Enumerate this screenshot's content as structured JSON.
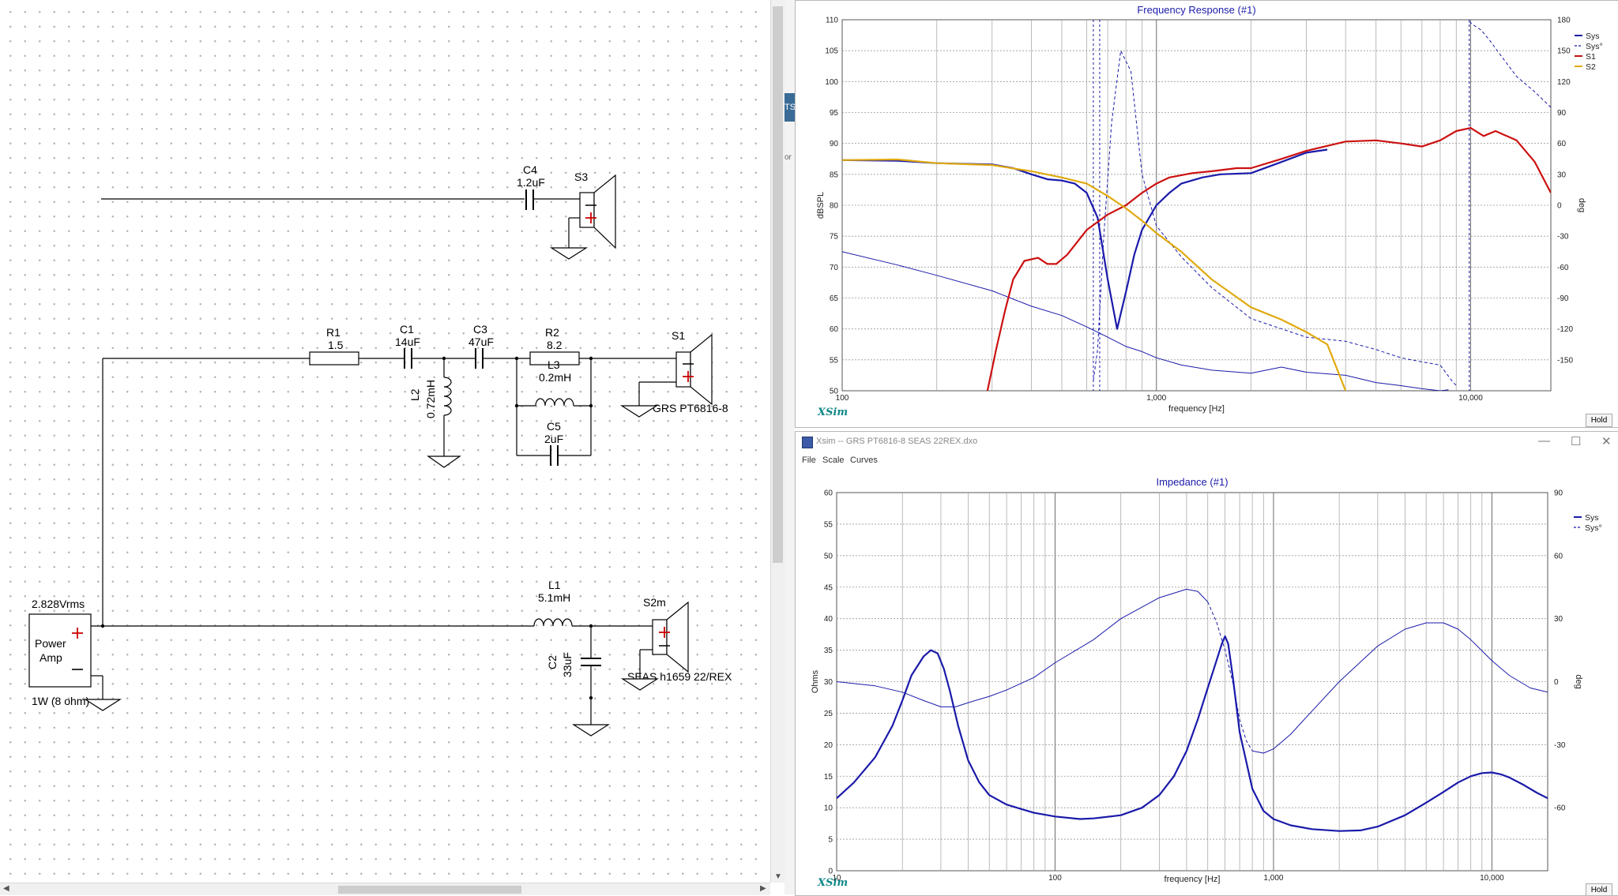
{
  "schematic": {
    "source": "2.828Vrms",
    "amp_line1": "Power",
    "amp_line2": "Amp",
    "amp_power": "1W (8 ohm)",
    "c4": {
      "name": "C4",
      "value": "1.2uF"
    },
    "s3": "S3",
    "r1": {
      "name": "R1",
      "value": "1.5"
    },
    "c1": {
      "name": "C1",
      "value": "14uF"
    },
    "c3": {
      "name": "C3",
      "value": "47uF"
    },
    "r2": {
      "name": "R2",
      "value": "8.2"
    },
    "l3": {
      "name": "L3",
      "value": "0.2mH"
    },
    "c5": {
      "name": "C5",
      "value": "2uF"
    },
    "l2": {
      "name": "L2",
      "value": "0.72mH"
    },
    "s1": {
      "name": "S1",
      "model": "GRS PT6816-8"
    },
    "l1": {
      "name": "L1",
      "value": "5.1mH"
    },
    "c2": {
      "name": "C2",
      "value": "33uF"
    },
    "s2": {
      "name": "S2m",
      "model": "SEAS h1659 22/REX"
    }
  },
  "background_fragments": {
    "tab": "TS",
    "text": "or"
  },
  "freq_window": {
    "hold": "Hold",
    "logo": "XSim"
  },
  "imp_window": {
    "title": "Xsim -- GRS PT6816-8 SEAS 22REX.dxo",
    "menu": [
      "File",
      "Scale",
      "Curves"
    ],
    "hold": "Hold",
    "logo": "XSim"
  },
  "colors": {
    "sys": "#1a1aaa",
    "s1": "#cc1111",
    "s2": "#e0aa10",
    "grid": "#888888"
  },
  "chart_data": [
    {
      "type": "line",
      "title": "Frequency Response (#1)",
      "xlabel": "frequency [Hz]",
      "ylabel": "dBSPL",
      "y2label": "deg",
      "xscale": "log",
      "xlim": [
        100,
        18000
      ],
      "ylim": [
        50,
        110
      ],
      "y2lim": [
        -180,
        180
      ],
      "xticks": [
        {
          "v": 100,
          "label": "100"
        },
        {
          "v": 1000,
          "label": "1,000"
        },
        {
          "v": 10000,
          "label": "10,000"
        }
      ],
      "yticks": [
        50,
        55,
        60,
        65,
        70,
        75,
        80,
        85,
        90,
        95,
        100,
        105,
        110
      ],
      "y2ticks": [
        -150,
        -120,
        -90,
        -60,
        -30,
        0,
        30,
        60,
        90,
        120,
        150,
        180
      ],
      "grid": true,
      "legend_position": "top-right",
      "legend": [
        "Sys",
        "Sys°",
        "S1",
        "S2"
      ],
      "series": [
        {
          "name": "Sys",
          "axis": "left",
          "color": "#1a1aaa",
          "width": 2.2,
          "dash": "",
          "x": [
            100,
            150,
            200,
            300,
            350,
            400,
            450,
            500,
            550,
            600,
            650,
            700,
            750,
            800,
            850,
            900,
            1000,
            1100,
            1200,
            1400,
            1600,
            2000,
            2500,
            3000,
            3500
          ],
          "y": [
            87.3,
            87.2,
            86.8,
            86.6,
            86.0,
            85.0,
            84.2,
            84.0,
            83.5,
            82.0,
            78.0,
            68.0,
            60.0,
            66.0,
            72.0,
            76.0,
            80.0,
            82.0,
            83.5,
            84.5,
            85.0,
            85.2,
            87.0,
            88.5,
            89.0
          ]
        },
        {
          "name": "Sys°",
          "axis": "right",
          "color": "#1a1aaa",
          "width": 1,
          "dash": "4,3",
          "x": [
            630,
            650,
            680,
            720,
            770,
            830,
            900,
            1000,
            1200,
            1500,
            2000,
            3000,
            4000,
            5000,
            6000,
            7000,
            8000,
            8700,
            9000
          ],
          "y": [
            -170,
            -140,
            -30,
            80,
            150,
            130,
            30,
            -20,
            -50,
            -80,
            -110,
            -128,
            -132,
            -140,
            -148,
            -152,
            -155,
            -170,
            -175
          ]
        },
        {
          "name": "Sys°",
          "axis": "right",
          "color": "#1a1aaa",
          "width": 1,
          "dash": "4,3",
          "x": [
            9900,
            10200,
            10800,
            11500,
            12500,
            14000,
            16000,
            18000
          ],
          "y": [
            178,
            175,
            170,
            160,
            145,
            125,
            110,
            95
          ]
        },
        {
          "name": "Sys°",
          "axis": "right",
          "color": "#1a1aaa",
          "width": 1,
          "dash": "",
          "x": [
            100,
            150,
            200,
            300,
            400,
            500,
            600,
            700,
            800,
            900,
            1000,
            1200,
            1500,
            2000,
            2500,
            3000,
            4000,
            5000,
            6000,
            7000,
            8000,
            8500
          ],
          "y": [
            -45,
            -58,
            -68,
            -83,
            -98,
            -107,
            -118,
            -128,
            -137,
            -142,
            -148,
            -155,
            -160,
            -163,
            -157,
            -162,
            -165,
            -172,
            -175,
            -178,
            -180,
            -179
          ]
        },
        {
          "name": "S1",
          "axis": "left",
          "color": "#cc1111",
          "width": 2.2,
          "dash": "",
          "x": [
            290,
            310,
            330,
            350,
            380,
            420,
            450,
            480,
            520,
            600,
            700,
            800,
            900,
            1000,
            1100,
            1300,
            1500,
            1800,
            2000,
            2500,
            3000,
            4000,
            5000,
            6000,
            7000,
            8000,
            9000,
            10000,
            11000,
            12000,
            14000,
            16000,
            18000
          ],
          "y": [
            50,
            57,
            63,
            68,
            71,
            71.5,
            70.5,
            70.5,
            72,
            76,
            78.5,
            80,
            82,
            83.5,
            84.5,
            85.2,
            85.5,
            86,
            86,
            87.5,
            88.8,
            90.3,
            90.5,
            90,
            89.5,
            90.5,
            92,
            92.5,
            91.2,
            92,
            90.5,
            87,
            82
          ]
        },
        {
          "name": "S2",
          "axis": "left",
          "color": "#e0aa10",
          "width": 2.2,
          "dash": "",
          "x": [
            100,
            150,
            200,
            300,
            400,
            500,
            600,
            700,
            800,
            900,
            1000,
            1200,
            1500,
            2000,
            2500,
            3000,
            3500,
            4000
          ],
          "y": [
            87.3,
            87.4,
            86.8,
            86.5,
            85.5,
            84.5,
            83.5,
            81.5,
            79.5,
            77.5,
            75.5,
            72.5,
            68,
            63.5,
            61.5,
            59.5,
            57.5,
            50
          ]
        }
      ],
      "vlines": [
        {
          "x": 630,
          "color": "#1a1aaa",
          "dash": "3,3"
        },
        {
          "x": 660,
          "color": "#1a1aaa",
          "dash": "3,3"
        },
        {
          "x": 9900,
          "color": "#1a1aaa",
          "dash": "3,3"
        }
      ]
    },
    {
      "type": "line",
      "title": "Impedance (#1)",
      "xlabel": "frequency [Hz]",
      "ylabel": "Ohms",
      "y2label": "deg",
      "xscale": "log",
      "xlim": [
        10,
        18000
      ],
      "ylim": [
        0,
        60
      ],
      "y2lim": [
        -90,
        90
      ],
      "xticks": [
        {
          "v": 10,
          "label": "10"
        },
        {
          "v": 100,
          "label": "100"
        },
        {
          "v": 1000,
          "label": "1,000"
        },
        {
          "v": 10000,
          "label": "10,000"
        }
      ],
      "yticks": [
        0,
        5,
        10,
        15,
        20,
        25,
        30,
        35,
        40,
        45,
        50,
        55,
        60
      ],
      "y2ticks": [
        -60,
        -30,
        0,
        30,
        60,
        90
      ],
      "grid": true,
      "legend_position": "top-right",
      "legend": [
        "Sys",
        "Sys°"
      ],
      "series": [
        {
          "name": "Sys",
          "axis": "left",
          "color": "#1a1aaa",
          "width": 2.2,
          "dash": "",
          "x": [
            10,
            12,
            15,
            18,
            20,
            22,
            25,
            27,
            29,
            31,
            33,
            36,
            40,
            45,
            50,
            60,
            70,
            80,
            100,
            130,
            150,
            200,
            250,
            300,
            350,
            400,
            450,
            500,
            550,
            580,
            600,
            620,
            650,
            700,
            800,
            900,
            1000,
            1200,
            1500,
            2000,
            2500,
            3000,
            4000,
            5000,
            6000,
            7000,
            8000,
            9000,
            10000,
            11000,
            12000,
            14000,
            16000,
            18000
          ],
          "y": [
            11.5,
            14,
            18,
            23,
            27,
            31,
            34,
            35,
            34.5,
            32,
            28.5,
            23,
            17.5,
            14,
            12,
            10.5,
            9.8,
            9.2,
            8.6,
            8.2,
            8.3,
            8.8,
            10,
            12,
            15,
            19,
            24,
            29,
            33.5,
            36,
            37.2,
            36,
            31,
            22,
            13,
            9.5,
            8.2,
            7.2,
            6.6,
            6.3,
            6.4,
            7,
            8.8,
            10.8,
            12.5,
            14,
            15,
            15.5,
            15.6,
            15.3,
            14.8,
            13.6,
            12.4,
            11.5
          ]
        },
        {
          "name": "Sys°",
          "axis": "right",
          "color": "#1a1aaa",
          "width": 1,
          "dash": "",
          "x": [
            10,
            15,
            20,
            25,
            30,
            35,
            40,
            50,
            60,
            80,
            100,
            150,
            200,
            300,
            400,
            450,
            500
          ],
          "y": [
            0,
            -2,
            -5,
            -9,
            -12,
            -12,
            -10,
            -7,
            -4,
            2,
            9,
            20,
            30,
            40,
            44,
            43,
            38
          ]
        },
        {
          "name": "Sys°",
          "axis": "right",
          "color": "#1a1aaa",
          "width": 1,
          "dash": "4,3",
          "x": [
            500,
            550,
            600,
            650,
            700,
            750,
            800
          ],
          "y": [
            38,
            28,
            15,
            0,
            -18,
            -28,
            -33
          ]
        },
        {
          "name": "Sys°",
          "axis": "right",
          "color": "#1a1aaa",
          "width": 1,
          "dash": "",
          "x": [
            800,
            900,
            1000,
            1200,
            1500,
            2000,
            3000,
            4000,
            5000,
            6000,
            7000,
            8000,
            10000,
            12000,
            15000,
            18000
          ],
          "y": [
            -33,
            -34,
            -32,
            -25,
            -14,
            0,
            17,
            25,
            28,
            28,
            25,
            20,
            10,
            3,
            -3,
            -5
          ]
        }
      ],
      "vlines": []
    }
  ]
}
